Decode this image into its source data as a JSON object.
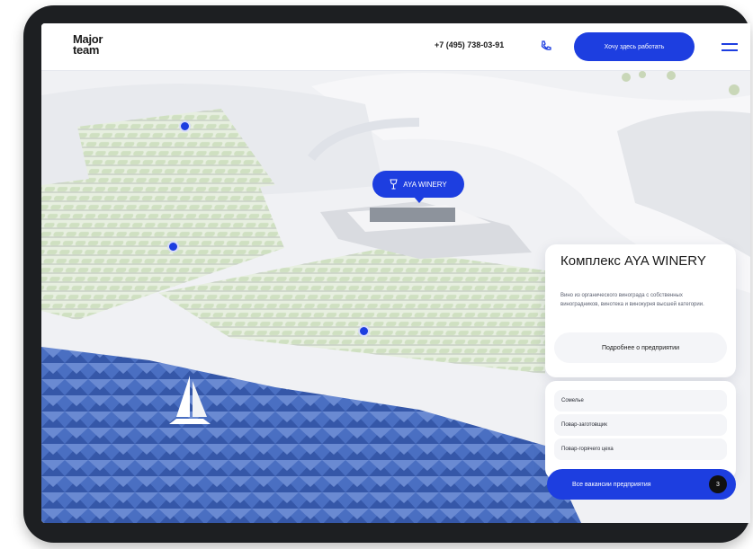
{
  "colors": {
    "accent": "#1d3ee0",
    "device_frame": "#1d1f22",
    "water": "#3f63b8"
  },
  "header": {
    "logo_line1": "Major",
    "logo_line2": "team",
    "phone": "+7 (495) 738-03-91",
    "cta_label": "Хочу здесь работать",
    "icons": {
      "phone": "phone-icon",
      "menu": "hamburger-menu-icon"
    }
  },
  "map": {
    "pin_label": "AYA WINERY",
    "pin_icon": "wine-glass-icon"
  },
  "card": {
    "title": "Комплекс AYA WINERY",
    "description": "Вино из органического винограда с собственных виноградников, винотека и винокурня высшей категории.",
    "details_button": "Подробнее о предприятии"
  },
  "list": {
    "items": [
      "Сомелье",
      "Повар-заготовщик",
      "Повар-горячего цеха"
    ]
  },
  "all_vacancies": {
    "label": "Все вакансии предприятия",
    "count": "3"
  }
}
